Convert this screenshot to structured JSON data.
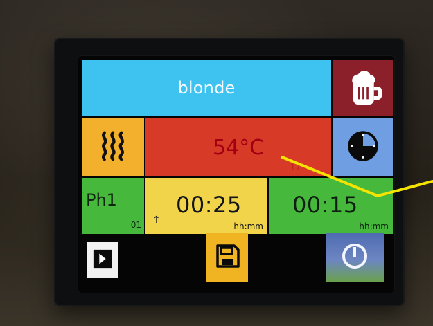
{
  "header": {
    "title": "blonde"
  },
  "status": {
    "temperature": "54°C",
    "small_indicator": "17"
  },
  "phase": {
    "label": "Ph1",
    "index": "01"
  },
  "timers": [
    {
      "value": "00:25",
      "unit": "hh:mm",
      "arrow": "↑"
    },
    {
      "value": "00:15",
      "unit": "hh:mm"
    }
  ],
  "icons": {
    "beer": "beer-mug-icon",
    "heat": "heat-waves-icon",
    "clock": "clock-icon",
    "skip": "skip-next-icon",
    "save": "floppy-disk-icon",
    "power": "power-icon"
  },
  "colors": {
    "title_bg": "#3ec2f0",
    "beer_bg": "#8b1f2a",
    "heat_bg": "#f2b02c",
    "temp_bg": "#d83a28",
    "clock_bg": "#6f9ee3",
    "phase_bg": "#46b83b",
    "timer1_bg": "#f1d44a",
    "timer2_bg": "#46b83b",
    "save_bg": "#f0b321"
  }
}
